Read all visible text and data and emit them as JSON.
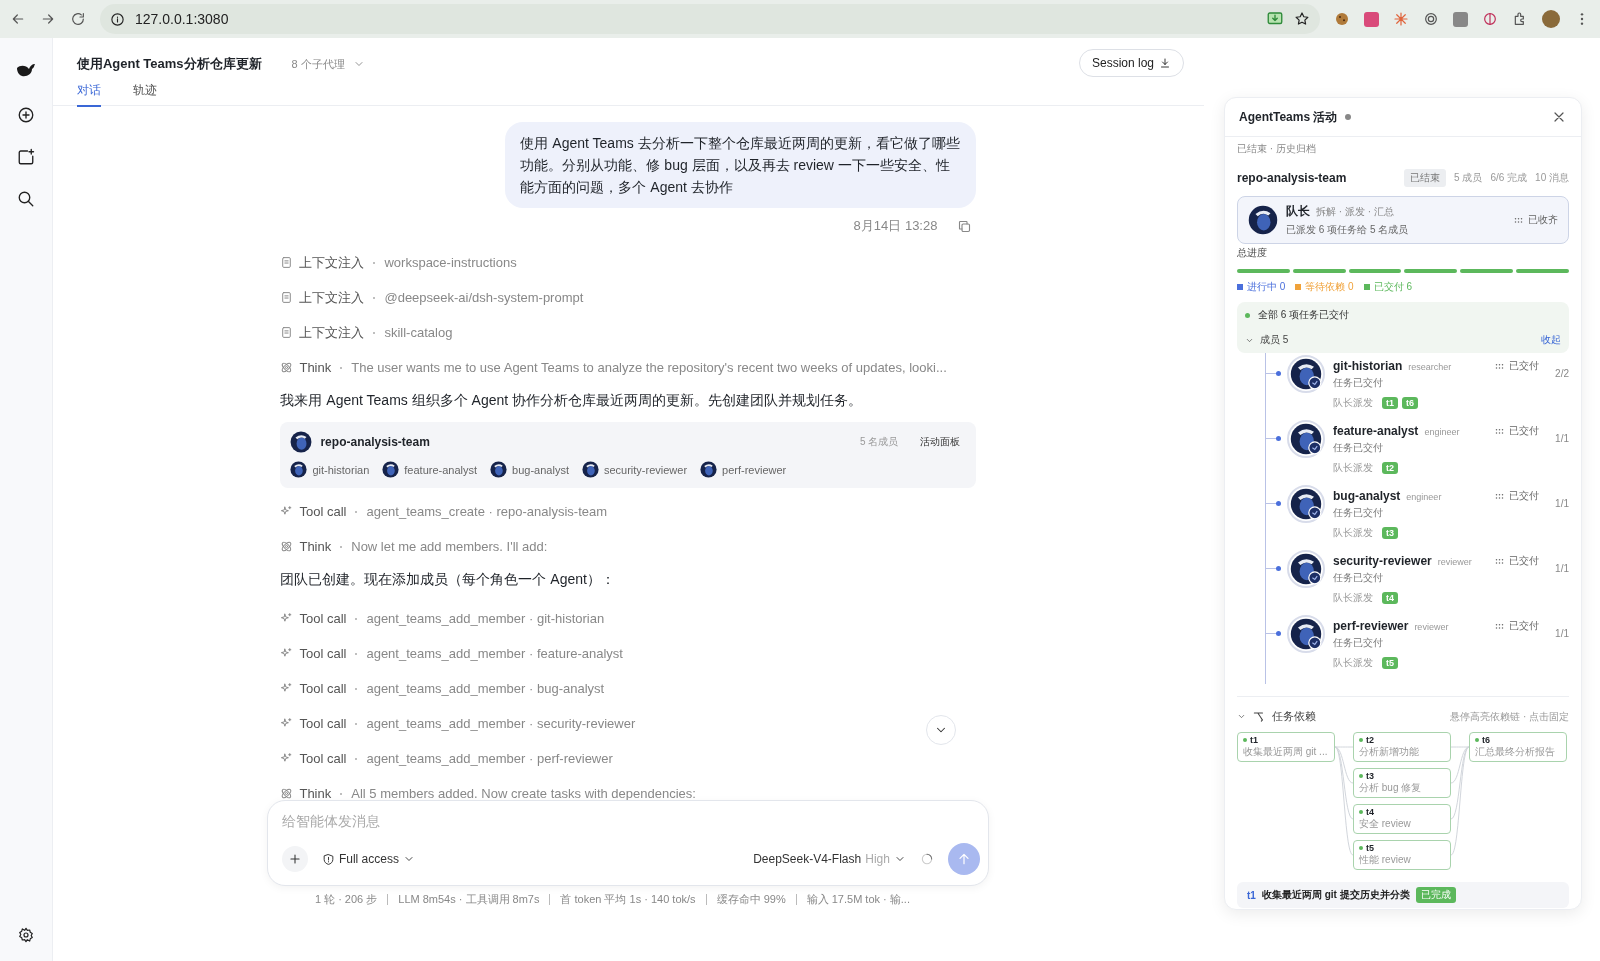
{
  "browser": {
    "url": "127.0.0.1:3080"
  },
  "header": {
    "title": "使用Agent Teams分析仓库更新",
    "agents": "8 个子代理",
    "session_log": "Session log"
  },
  "tabs": [
    {
      "label": "对话",
      "selected": true
    },
    {
      "label": "轨迹",
      "selected": false
    }
  ],
  "user_message": {
    "text": "使用 Agent Teams 去分析一下整个仓库最近两周的更新，看它做了哪些功能。分别从功能、修 bug 层面，以及再去 review 一下一些安全、性能方面的问题，多个 Agent 去协作",
    "time": "8月14日 13:28"
  },
  "steps": [
    {
      "kind": "context",
      "label": "上下文注入",
      "detail": "workspace-instructions"
    },
    {
      "kind": "context",
      "label": "上下文注入",
      "detail": "@deepseek-ai/dsh-system-prompt"
    },
    {
      "kind": "context",
      "label": "上下文注入",
      "detail": "skill-catalog"
    },
    {
      "kind": "think",
      "label": "Think",
      "detail": "The user wants me to use Agent Teams to analyze the repository's recent two weeks of updates, looki..."
    },
    {
      "kind": "text",
      "text": "我来用 Agent Teams 组织多个 Agent 协作分析仓库最近两周的更新。先创建团队并规划任务。"
    },
    {
      "kind": "team",
      "name": "repo-analysis-team",
      "count": "5 名成员",
      "action": "活动面板",
      "members": [
        "git-historian",
        "feature-analyst",
        "bug-analyst",
        "security-reviewer",
        "perf-reviewer"
      ]
    },
    {
      "kind": "tool",
      "label": "Tool call",
      "detail": "agent_teams_create · repo-analysis-team"
    },
    {
      "kind": "think",
      "label": "Think",
      "detail": "Now let me add members. I'll add:"
    },
    {
      "kind": "text",
      "text": "团队已创建。现在添加成员（每个角色一个 Agent）："
    },
    {
      "kind": "tool",
      "label": "Tool call",
      "detail": "agent_teams_add_member · git-historian"
    },
    {
      "kind": "tool",
      "label": "Tool call",
      "detail": "agent_teams_add_member · feature-analyst"
    },
    {
      "kind": "tool",
      "label": "Tool call",
      "detail": "agent_teams_add_member · bug-analyst"
    },
    {
      "kind": "tool",
      "label": "Tool call",
      "detail": "agent_teams_add_member · security-reviewer"
    },
    {
      "kind": "tool",
      "label": "Tool call",
      "detail": "agent_teams_add_member · perf-reviewer"
    },
    {
      "kind": "think",
      "label": "Think",
      "detail": "All 5 members added. Now create tasks with dependencies:"
    }
  ],
  "composer": {
    "placeholder": "给智能体发消息",
    "access": "Full access",
    "model": "DeepSeek-V4-Flash",
    "effort": "High"
  },
  "stats": [
    "1 轮 · 206 步",
    "LLM 8m54s · 工具调用 8m7s",
    "首 token 平均 1s · 140 tok/s",
    "缓存命中 99%",
    "输入 17.5M tok · 输..."
  ],
  "panel": {
    "title": "AgentTeams 活动",
    "subtitle": "已结束 · 历史归档",
    "team": "repo-analysis-team",
    "badge": "已结束",
    "team_stats": [
      "5 成员",
      "6/6 完成",
      "10 消息"
    ],
    "leader": {
      "name": "队长",
      "role": "拆解 · 派发 · 汇总",
      "desc": "已派发 6 项任务给 5 名成员",
      "status": "已收齐"
    },
    "progress_label": "总进度",
    "segments": [
      {
        "done": true
      },
      {
        "done": true
      },
      {
        "done": true
      },
      {
        "done": true
      },
      {
        "done": true
      },
      {
        "done": true
      }
    ],
    "legend": [
      {
        "label": "进行中 0",
        "color": "#4a6fdc"
      },
      {
        "label": "等待依赖 0",
        "color": "#f0a23a"
      },
      {
        "label": "已交付 6",
        "color": "#5cb85c"
      }
    ],
    "banner": "全部 6 项任务已交付",
    "members_header": {
      "label": "成员 5",
      "expanded": true,
      "action": "收起"
    },
    "members": [
      {
        "name": "git-historian",
        "role": "researcher",
        "status": "已交付",
        "desc": "任务已交付",
        "assigned": "队长派发",
        "tags": [
          "t1",
          "t6"
        ],
        "count": "2/2"
      },
      {
        "name": "feature-analyst",
        "role": "engineer",
        "status": "已交付",
        "desc": "任务已交付",
        "assigned": "队长派发",
        "tags": [
          "t2"
        ],
        "count": "1/1"
      },
      {
        "name": "bug-analyst",
        "role": "engineer",
        "status": "已交付",
        "desc": "任务已交付",
        "assigned": "队长派发",
        "tags": [
          "t3"
        ],
        "count": "1/1"
      },
      {
        "name": "security-reviewer",
        "role": "reviewer",
        "status": "已交付",
        "desc": "任务已交付",
        "assigned": "队长派发",
        "tags": [
          "t4"
        ],
        "count": "1/1"
      },
      {
        "name": "perf-reviewer",
        "role": "reviewer",
        "status": "已交付",
        "desc": "任务已交付",
        "assigned": "队长派发",
        "tags": [
          "t5"
        ],
        "count": "1/1"
      }
    ],
    "deps": {
      "title": "任务依赖",
      "expanded": true,
      "hint": "悬停高亮依赖链 · 点击固定",
      "columns": [
        [
          {
            "id": "t1",
            "desc": "收集最近两周 git ..."
          }
        ],
        [
          {
            "id": "t2",
            "desc": "分析新增功能"
          },
          {
            "id": "t3",
            "desc": "分析 bug 修复"
          },
          {
            "id": "t4",
            "desc": "安全 review"
          },
          {
            "id": "t5",
            "desc": "性能 review"
          }
        ],
        [
          {
            "id": "t6",
            "desc": "汇总最终分析报告"
          }
        ]
      ]
    },
    "footer": {
      "id": "t1",
      "text": "收集最近两周 git 提交历史并分类",
      "badge": "已完成"
    }
  }
}
